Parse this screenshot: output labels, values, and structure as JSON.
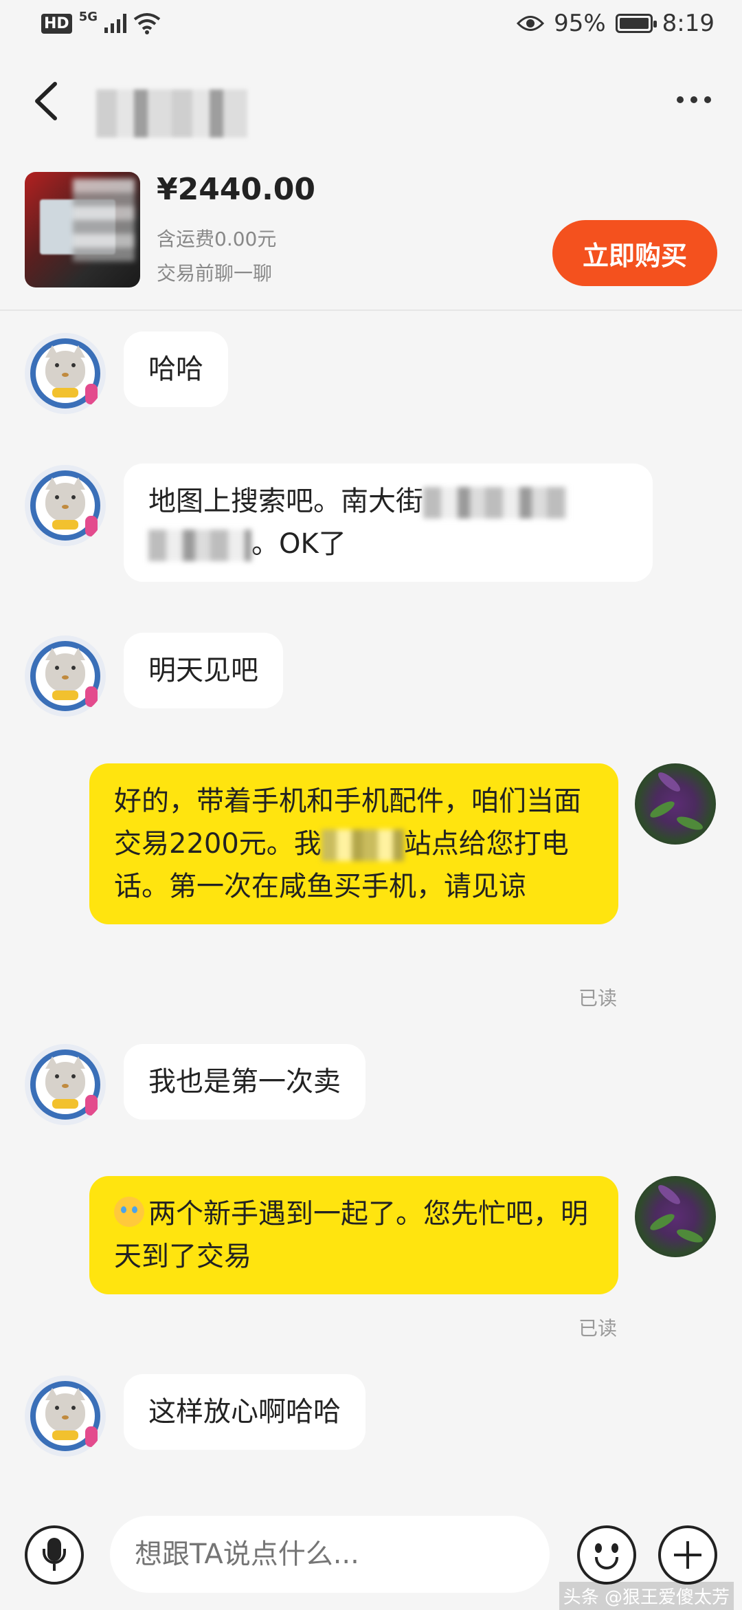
{
  "status": {
    "network": "5G",
    "hd": "HD",
    "battery": "95%",
    "time": "8:19"
  },
  "header": {
    "back_icon": "chevron-left-icon",
    "more_icon": "more-dots-icon"
  },
  "product": {
    "price": "¥2440.00",
    "shipping": "含运费0.00元",
    "note": "交易前聊一聊",
    "buy_label": "立即购买",
    "buy_color": "#f4511e"
  },
  "messages": [
    {
      "from": "seller",
      "text": "哈哈"
    },
    {
      "from": "seller",
      "text_a": "地图上搜索吧。南大街",
      "text_b": "。OK了"
    },
    {
      "from": "seller",
      "text": "明天见吧"
    },
    {
      "from": "me",
      "text_a": "好的，带着手机和手机配件，咱们当面交易2200元。我",
      "text_b": "站点给您打电话。第一次在咸鱼买手机，请见谅",
      "status": "已读"
    },
    {
      "from": "seller",
      "text": "我也是第一次卖"
    },
    {
      "from": "me",
      "text": "两个新手遇到一起了。您先忙吧，明天到了交易",
      "status": "已读"
    },
    {
      "from": "seller",
      "text": "这样放心啊哈哈"
    }
  ],
  "input": {
    "placeholder": "想跟TA说点什么..."
  },
  "watermark": "头条 @狠王爱傻太芳",
  "colors": {
    "bubble_out": "#ffe40f",
    "bubble_in": "#ffffff",
    "background": "#f5f5f5"
  }
}
